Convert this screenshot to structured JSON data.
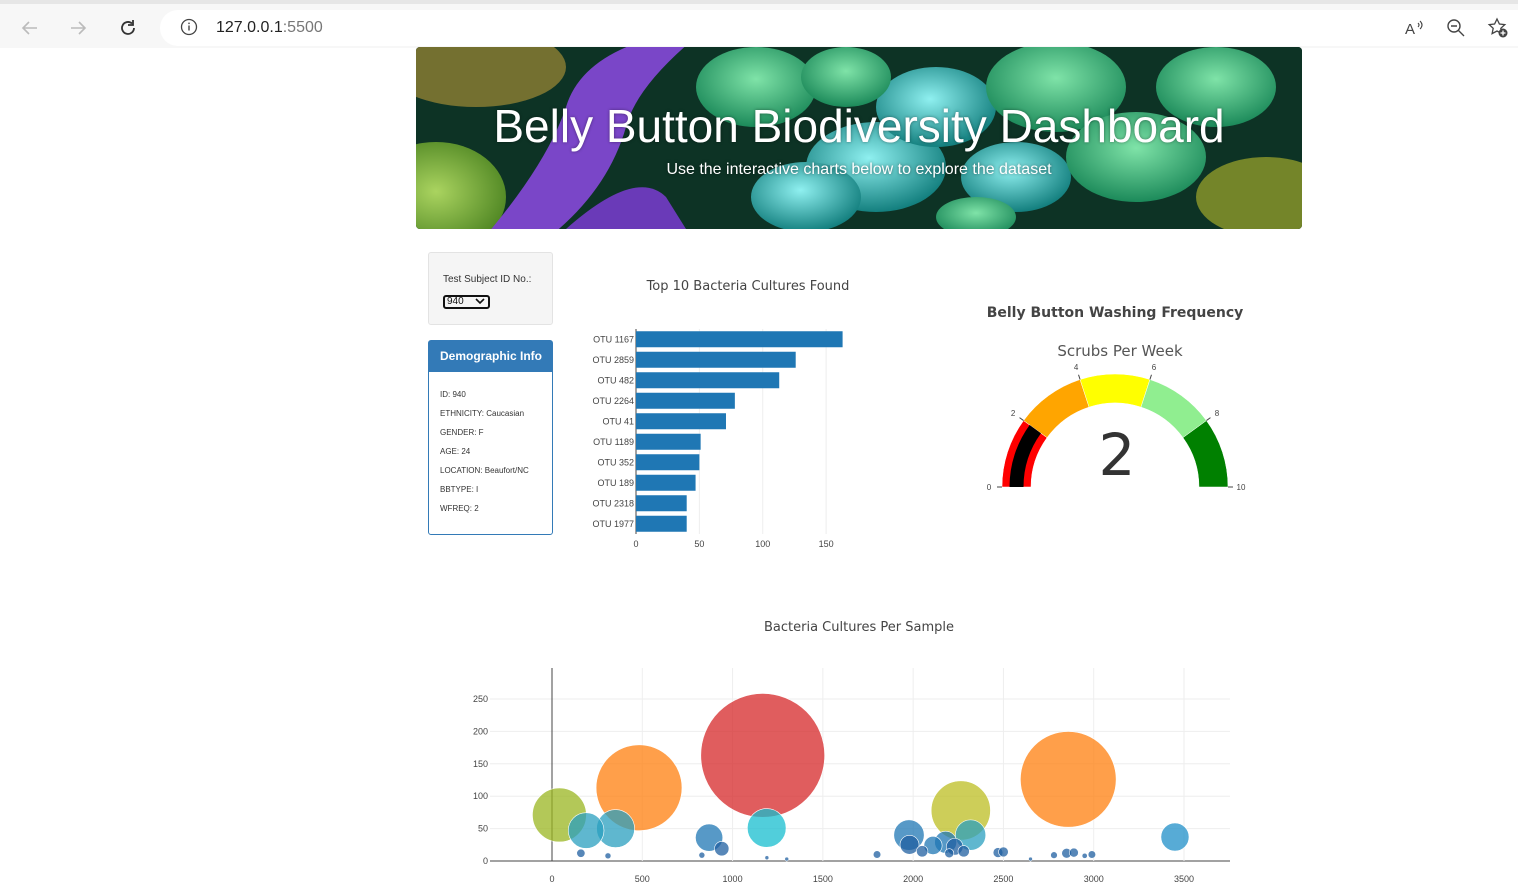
{
  "browser": {
    "url_host": "127.0.0.1",
    "url_port": ":5500"
  },
  "header": {
    "title": "Belly Button Biodiversity Dashboard",
    "subtitle": "Use the interactive charts below to explore the dataset"
  },
  "selector": {
    "label": "Test Subject ID No.:",
    "selected": "940"
  },
  "demographics": {
    "title": "Demographic Info",
    "lines": [
      "ID: 940",
      "ETHNICITY: Caucasian",
      "GENDER: F",
      "AGE: 24",
      "LOCATION: Beaufort/NC",
      "BBTYPE: I",
      "WFREQ: 2"
    ]
  },
  "colors": {
    "bar": "#1f77b4",
    "panel": "#337ab7"
  },
  "chart_data": [
    {
      "type": "bar",
      "orientation": "horizontal",
      "title": "Top 10 Bacteria Cultures Found",
      "categories": [
        "OTU 1167",
        "OTU 2859",
        "OTU 482",
        "OTU 2264",
        "OTU 41",
        "OTU 1189",
        "OTU 352",
        "OTU 189",
        "OTU 2318",
        "OTU 1977"
      ],
      "values": [
        163,
        126,
        113,
        78,
        71,
        51,
        50,
        47,
        40,
        40
      ],
      "xticks": [
        0,
        50,
        100,
        150
      ],
      "xlim": [
        0,
        172
      ],
      "grid": true
    },
    {
      "type": "gauge",
      "title": "Belly Button Washing Frequency",
      "subtitle": "Scrubs Per Week",
      "value": 2,
      "range": [
        0,
        10
      ],
      "ticks": [
        0,
        2,
        4,
        6,
        8,
        10
      ],
      "steps": [
        {
          "range": [
            0,
            2
          ],
          "color": "#ff0000"
        },
        {
          "range": [
            2,
            4
          ],
          "color": "#ffa500"
        },
        {
          "range": [
            4,
            6
          ],
          "color": "#ffff00"
        },
        {
          "range": [
            6,
            8
          ],
          "color": "#90ee90"
        },
        {
          "range": [
            8,
            10
          ],
          "color": "#008000"
        }
      ],
      "bar_color": "#000000"
    },
    {
      "type": "scatter",
      "title": "Bacteria Cultures Per Sample",
      "xticks": [
        0,
        500,
        1000,
        1500,
        2000,
        2500,
        3000,
        3500
      ],
      "yticks": [
        0,
        50,
        100,
        150,
        200,
        250
      ],
      "xlim": [
        0,
        3750
      ],
      "ylim": [
        0,
        300
      ],
      "grid": true,
      "points": [
        {
          "x": 1167,
          "y": 163,
          "size": 163,
          "color": "#d62728"
        },
        {
          "x": 2859,
          "y": 126,
          "size": 126,
          "color": "#ff7f0e"
        },
        {
          "x": 482,
          "y": 113,
          "size": 113,
          "color": "#ff7f0e"
        },
        {
          "x": 2264,
          "y": 78,
          "size": 78,
          "color": "#bcbd22"
        },
        {
          "x": 41,
          "y": 71,
          "size": 71,
          "color": "#9ab520"
        },
        {
          "x": 1189,
          "y": 51,
          "size": 51,
          "color": "#17becf"
        },
        {
          "x": 352,
          "y": 50,
          "size": 50,
          "color": "#2a9fbf"
        },
        {
          "x": 189,
          "y": 47,
          "size": 47,
          "color": "#2a9fbf"
        },
        {
          "x": 2318,
          "y": 40,
          "size": 40,
          "color": "#2a9fbf"
        },
        {
          "x": 1977,
          "y": 40,
          "size": 40,
          "color": "#1f77b4"
        },
        {
          "x": 3450,
          "y": 37,
          "size": 37,
          "color": "#1f8fc8"
        },
        {
          "x": 870,
          "y": 36,
          "size": 36,
          "color": "#1f77b4"
        },
        {
          "x": 2180,
          "y": 29,
          "size": 29,
          "color": "#1f77b4"
        },
        {
          "x": 2110,
          "y": 24,
          "size": 24,
          "color": "#1f77b4"
        },
        {
          "x": 1980,
          "y": 25,
          "size": 25,
          "color": "#1f5fa0"
        },
        {
          "x": 2230,
          "y": 22,
          "size": 22,
          "color": "#1f5fa0"
        },
        {
          "x": 940,
          "y": 19,
          "size": 19,
          "color": "#1f5fa0"
        },
        {
          "x": 2050,
          "y": 15,
          "size": 15,
          "color": "#1f5fa0"
        },
        {
          "x": 2200,
          "y": 12,
          "size": 12,
          "color": "#1f5fa0"
        },
        {
          "x": 2280,
          "y": 15,
          "size": 15,
          "color": "#1f5fa0"
        },
        {
          "x": 2470,
          "y": 13,
          "size": 13,
          "color": "#1f5fa0"
        },
        {
          "x": 2500,
          "y": 14,
          "size": 13,
          "color": "#1f5fa0"
        },
        {
          "x": 2850,
          "y": 12,
          "size": 13,
          "color": "#1f5fa0"
        },
        {
          "x": 2890,
          "y": 13,
          "size": 12,
          "color": "#1f5fa0"
        },
        {
          "x": 2990,
          "y": 10,
          "size": 10,
          "color": "#1f5fa0"
        },
        {
          "x": 2780,
          "y": 9,
          "size": 9,
          "color": "#1f5fa0"
        },
        {
          "x": 1800,
          "y": 10,
          "size": 10,
          "color": "#1f5fa0"
        },
        {
          "x": 160,
          "y": 12,
          "size": 11,
          "color": "#1f5fa0"
        },
        {
          "x": 310,
          "y": 8,
          "size": 8,
          "color": "#1f5fa0"
        },
        {
          "x": 830,
          "y": 9,
          "size": 8,
          "color": "#1f5fa0"
        },
        {
          "x": 2950,
          "y": 8,
          "size": 7,
          "color": "#1f5fa0"
        },
        {
          "x": 1190,
          "y": 5,
          "size": 5,
          "color": "#1f5fa0"
        },
        {
          "x": 1300,
          "y": 3,
          "size": 3,
          "color": "#1f5fa0"
        },
        {
          "x": 2650,
          "y": 3,
          "size": 3,
          "color": "#1f5fa0"
        }
      ]
    }
  ]
}
